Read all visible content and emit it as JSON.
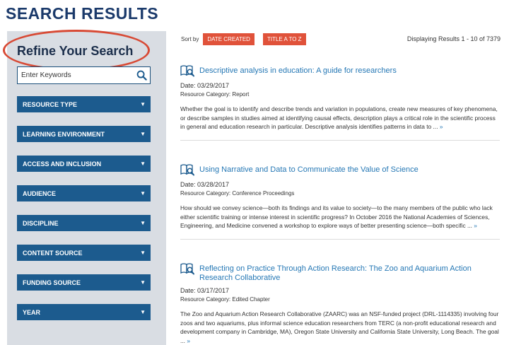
{
  "page": {
    "title": "SEARCH RESULTS"
  },
  "sidebar": {
    "title": "Refine Your Search",
    "search": {
      "value": "Enter Keywords",
      "placeholder": "Enter Keywords"
    },
    "facets": [
      {
        "label": "RESOURCE TYPE"
      },
      {
        "label": "LEARNING ENVIRONMENT"
      },
      {
        "label": "ACCESS AND INCLUSION"
      },
      {
        "label": "AUDIENCE"
      },
      {
        "label": "DISCIPLINE"
      },
      {
        "label": "CONTENT SOURCE"
      },
      {
        "label": "FUNDING SOURCE"
      },
      {
        "label": "YEAR"
      }
    ],
    "caret": "▼"
  },
  "sort": {
    "label": "Sort by",
    "date_button": "DATE CREATED",
    "title_button": "TITLE A TO Z",
    "results_text": "Displaying Results 1 - 10 of 7379"
  },
  "results": [
    {
      "title": "Descriptive analysis in education: A guide for researchers",
      "date": "Date: 03/29/2017",
      "category": "Resource Category: Report",
      "description": "Whether the goal is to identify and describe trends and variation in populations, create new measures of key phenomena, or describe samples in studies aimed at identifying causal effects, description plays a critical role in the scientific process in general and education research in particular. Descriptive analysis identifies patterns in data to ...",
      "more": "»"
    },
    {
      "title": "Using Narrative and Data to Communicate the Value of Science",
      "date": "Date: 03/28/2017",
      "category": "Resource Category: Conference Proceedings",
      "description": "How should we convey science—both its findings and its value to society—to the many members of the public who lack either scientific training or intense interest in scientific progress? In October 2016 the National Academies of Sciences, Engineering, and Medicine convened a workshop to explore ways of better presenting science—both specific ...",
      "more": "»"
    },
    {
      "title": "Reflecting on Practice Through Action Research: The Zoo and Aquarium Action Research Collaborative",
      "date": "Date: 03/17/2017",
      "category": "Resource Category: Edited Chapter",
      "description": "The Zoo and Aquarium Action Research Collaborative (ZAARC) was an NSF-funded project (DRL-1114335) involving four zoos and two aquariums, plus informal science education researchers from TERC (a non-profit educational research and development company in Cambridge, MA), Oregon State University and California State University, Long Beach. The goal ...",
      "more": "»"
    }
  ],
  "colors": {
    "title": "#1b3a6b",
    "facet_bg": "#1c5b8e",
    "sort_button_bg": "#e0523a",
    "link": "#2678b5",
    "highlight": "#d84a35",
    "sidebar_bg": "#d9dde3"
  },
  "icons": {
    "search": "search-icon",
    "book": "book-icon",
    "facet_caret": "chevron-down-icon"
  }
}
